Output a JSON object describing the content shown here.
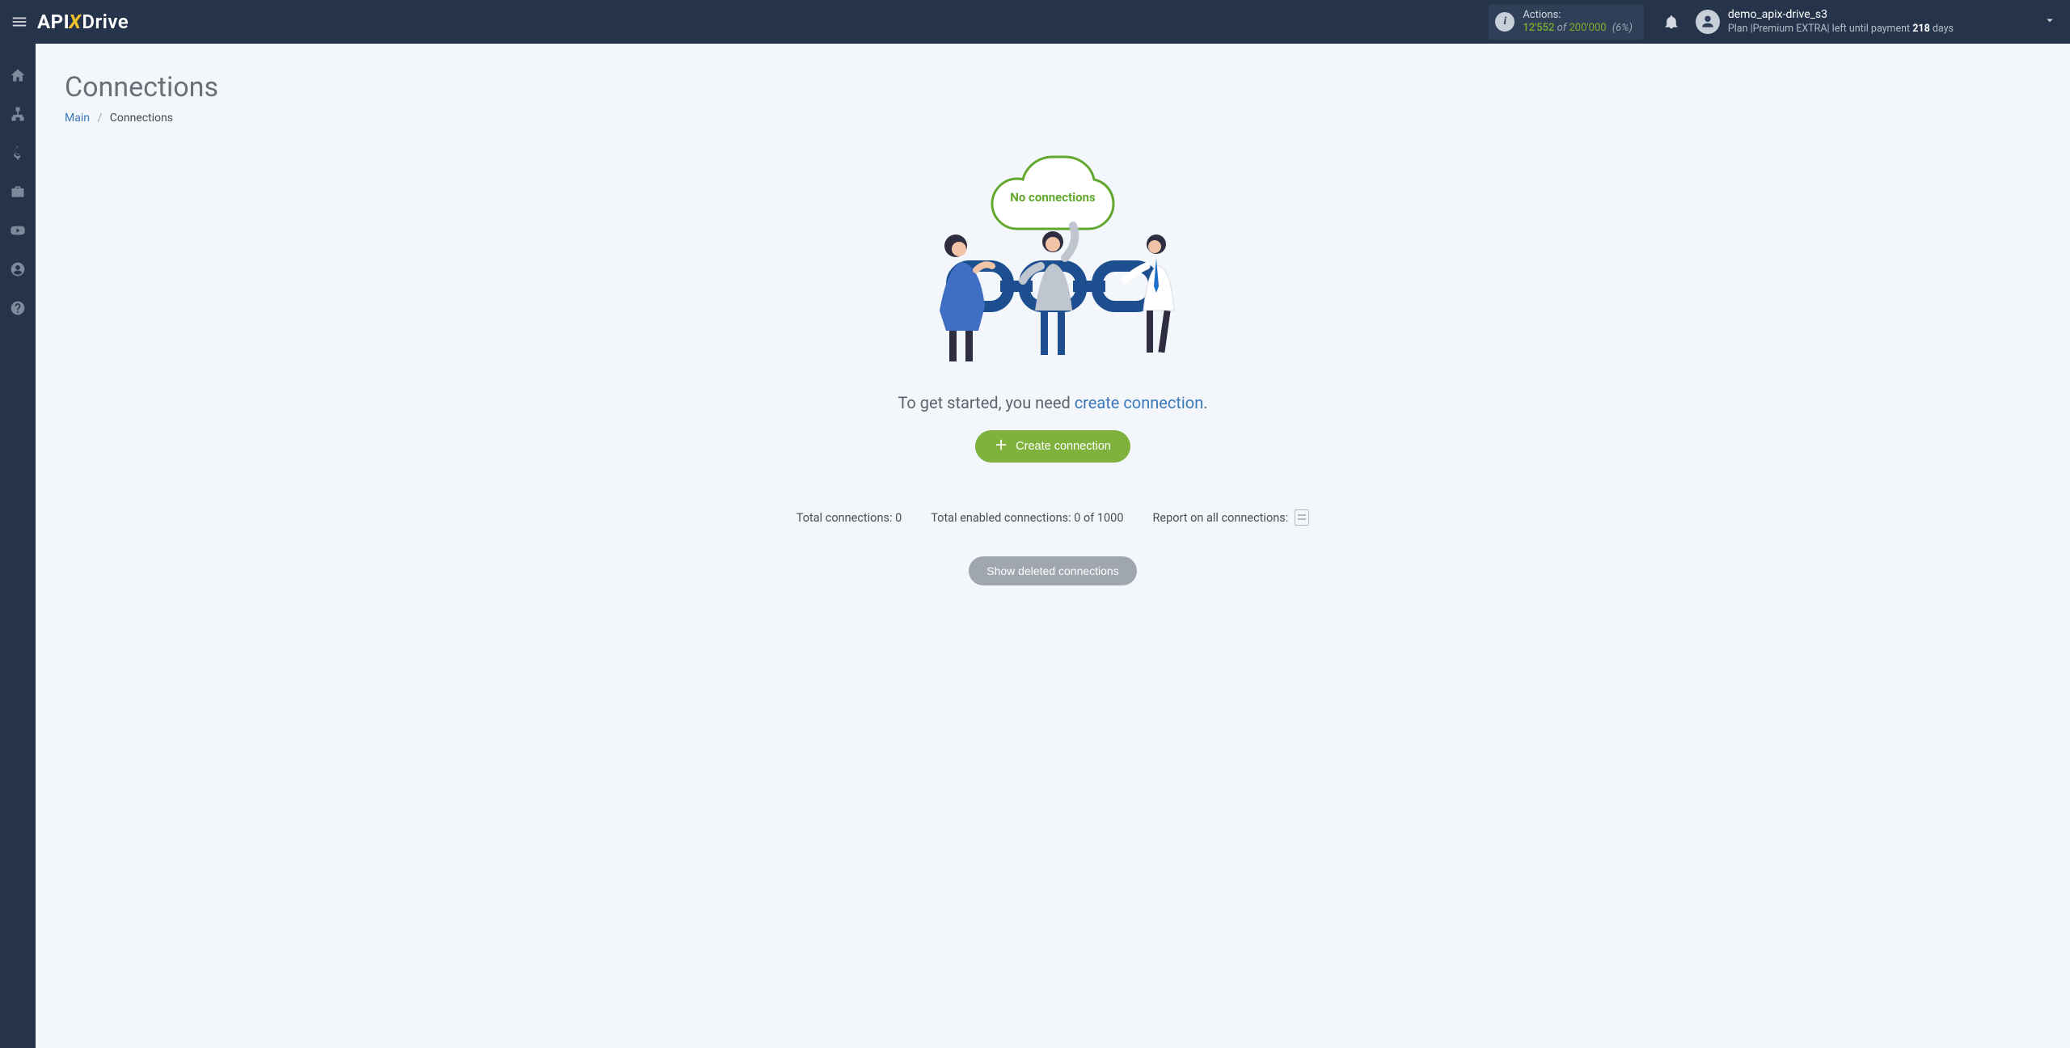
{
  "brand": {
    "part1": "API",
    "x": "X",
    "part2": "Drive"
  },
  "header": {
    "actions": {
      "label": "Actions:",
      "used": "12'552",
      "of": "of",
      "limit": "200'000",
      "pct": "(6%)"
    },
    "user": {
      "name": "demo_apix-drive_s3",
      "plan_prefix": "Plan |",
      "plan_name": "Premium EXTRA",
      "plan_mid": "| left until payment ",
      "plan_days": "218",
      "plan_days_suffix": " days"
    }
  },
  "sidebar": {
    "items": [
      {
        "name": "home"
      },
      {
        "name": "connections"
      },
      {
        "name": "billing"
      },
      {
        "name": "briefcase"
      },
      {
        "name": "video"
      },
      {
        "name": "account"
      },
      {
        "name": "help"
      }
    ]
  },
  "page": {
    "title": "Connections",
    "breadcrumb": {
      "root": "Main",
      "current": "Connections",
      "sep": "/"
    },
    "empty": {
      "cloud_text": "No connections",
      "prompt_prefix": "To get started, you need ",
      "prompt_link": "create connection",
      "prompt_suffix": ".",
      "create_btn": "Create connection"
    },
    "stats": {
      "total_label": "Total connections:",
      "total_value": "0",
      "enabled_label": "Total enabled connections:",
      "enabled_value": "0 of 1000",
      "report_label": "Report on all connections:"
    },
    "show_deleted_btn": "Show deleted connections"
  }
}
